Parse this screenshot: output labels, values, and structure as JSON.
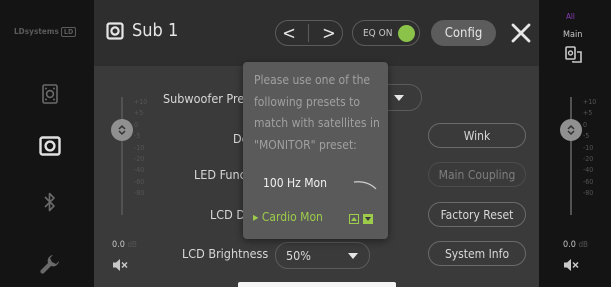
{
  "sidebar": {
    "brand": "LDsystems",
    "brand_box": "LD",
    "icons": [
      "subwoofer-icon",
      "speaker-icon",
      "bluetooth-icon",
      "wrench-icon"
    ]
  },
  "header": {
    "title": "Sub 1",
    "prev_glyph": "<",
    "next_glyph": ">",
    "eq_label": "EQ ON",
    "config_label": "Config"
  },
  "fader_left": {
    "scale": [
      "+10",
      "+5",
      "0",
      "-5",
      "-10",
      "-20",
      "-40",
      "-60",
      "-80"
    ],
    "db_value": "0.0",
    "db_unit": "dB"
  },
  "settings": {
    "subwoofer_preset_label": "Subwoofer Preset",
    "delay_label": "Delay",
    "led_function_label": "LED Function",
    "lcd_display_label": "LCD Display",
    "lcd_brightness_label": "LCD Brightness",
    "lcd_brightness_value": "50%"
  },
  "buttons": {
    "wink": "Wink",
    "main_coupling": "Main Coupling",
    "factory_reset": "Factory Reset",
    "system_info": "System Info"
  },
  "popup": {
    "message": "Please use one of the following presets to match with satellites in \"MONITOR\" preset:",
    "option1": "100 Hz Mon",
    "option2": "Cardio Mon"
  },
  "right_panel": {
    "all_label": "All",
    "main_label": "Main",
    "db_value": "0.0",
    "db_unit": "dB"
  },
  "colors": {
    "accent_green": "#9ccc4a",
    "eq_on_dot": "#8bc34a",
    "all_purple": "#8a3db8"
  }
}
